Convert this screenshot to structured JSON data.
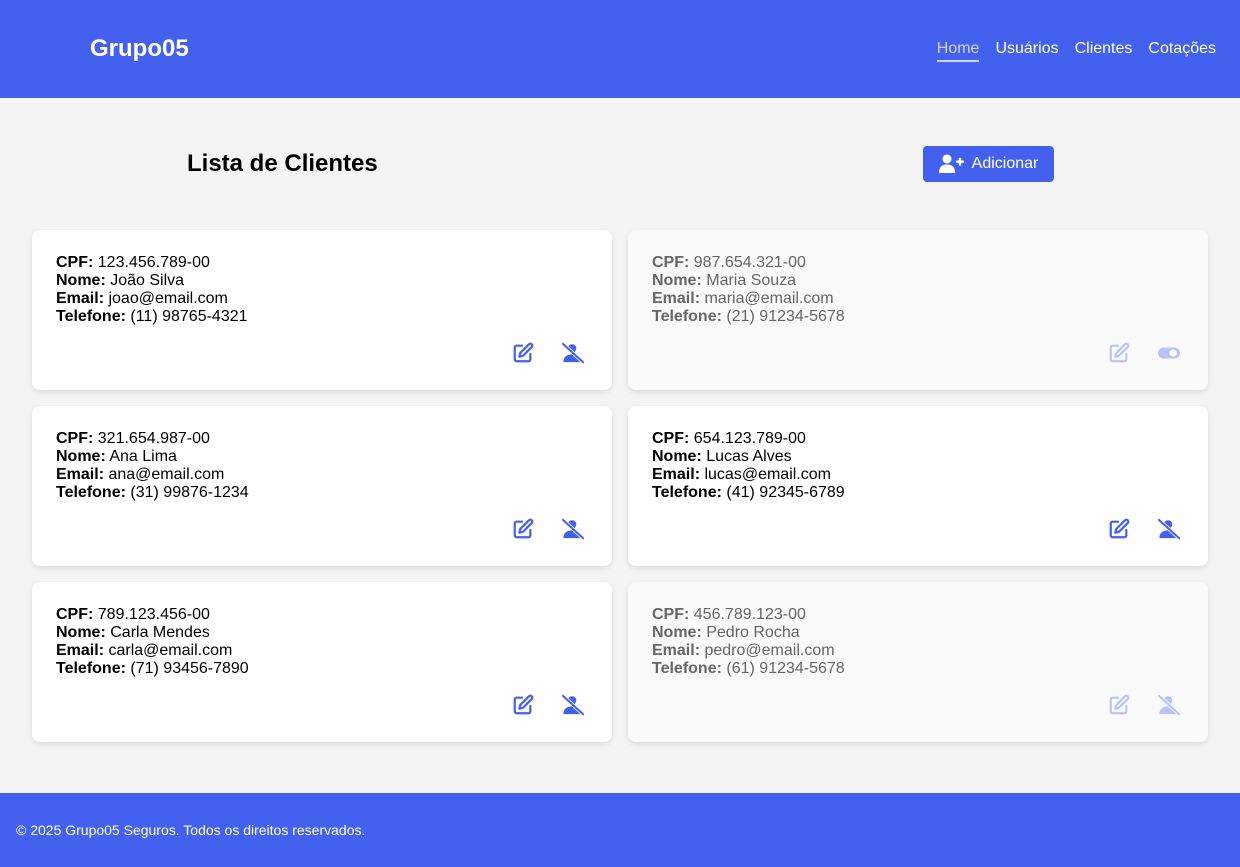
{
  "header": {
    "brand": "Grupo05",
    "nav": [
      "Home",
      "Usuários",
      "Clientes",
      "Cotações"
    ]
  },
  "main": {
    "title": "Lista de Clientes",
    "add_label": "Adicionar"
  },
  "labels": {
    "cpf": "CPF:",
    "nome": "Nome:",
    "email": "Email:",
    "telefone": "Telefone:"
  },
  "clients": [
    {
      "cpf": "123.456.789-00",
      "nome": "João Silva",
      "email": "joao@email.com",
      "telefone": "(11) 98765-4321",
      "active": true
    },
    {
      "cpf": "987.654.321-00",
      "nome": "Maria Souza",
      "email": "maria@email.com",
      "telefone": "(21) 91234-5678",
      "active": false
    },
    {
      "cpf": "321.654.987-00",
      "nome": "Ana Lima",
      "email": "ana@email.com",
      "telefone": "(31) 99876-1234",
      "active": true
    },
    {
      "cpf": "654.123.789-00",
      "nome": "Lucas Alves",
      "email": "lucas@email.com",
      "telefone": "(41) 92345-6789",
      "active": true
    },
    {
      "cpf": "789.123.456-00",
      "nome": "Carla Mendes",
      "email": "carla@email.com",
      "telefone": "(71) 93456-7890",
      "active": true
    },
    {
      "cpf": "456.789.123-00",
      "nome": "Pedro Rocha",
      "email": "pedro@email.com",
      "telefone": "(61) 91234-5678",
      "active": false
    }
  ],
  "icons": {
    "add": "user-plus-icon",
    "edit": "edit-icon",
    "deactivate": "user-slash-icon",
    "activate": "toggle-on-icon"
  },
  "colors": {
    "primary": "#4361ee",
    "background": "#f4f4f4"
  },
  "footer": {
    "text": "© 2025 Grupo05 Seguros. Todos os direitos reservados."
  }
}
